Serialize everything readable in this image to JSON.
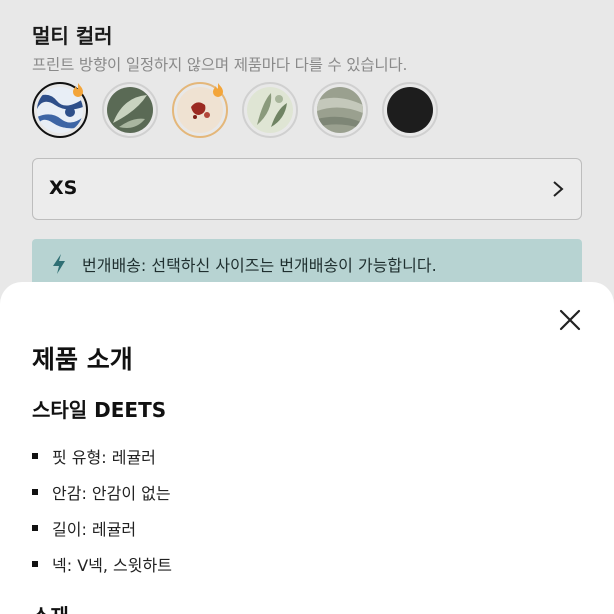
{
  "color_section": {
    "title": "멀티 컬러",
    "subtitle": "프린트 방향이 일정하지 않으며 제품마다 다를 수 있습니다."
  },
  "swatches": [
    {
      "name": "blue-white-print",
      "selected": true,
      "flame": true,
      "colors": [
        "#2e4f8a",
        "#e8eef6"
      ]
    },
    {
      "name": "green-leaf-print",
      "selected": false,
      "flame": false,
      "colors": [
        "#5a6a55",
        "#c9d3c0"
      ]
    },
    {
      "name": "cream-red-print",
      "selected": false,
      "flame": true,
      "colors": [
        "#efe2d2",
        "#9b2a22"
      ]
    },
    {
      "name": "sage-floral-print",
      "selected": false,
      "flame": false,
      "colors": [
        "#8a9a7c",
        "#dfe5d4"
      ]
    },
    {
      "name": "grey-marble-print",
      "selected": false,
      "flame": false,
      "colors": [
        "#7e8676",
        "#c4c8bb"
      ]
    },
    {
      "name": "solid-black",
      "selected": false,
      "flame": false,
      "colors": [
        "#1d1d1d",
        "#1d1d1d"
      ]
    }
  ],
  "size_selector": {
    "value": "XS"
  },
  "shipping_notice": {
    "text": "번개배송: 선택하신 사이즈는 번개배송이 가능합니다."
  },
  "product_sheet": {
    "title": "제품 소개",
    "style_heading": "스타일 DEETS",
    "specs": [
      "핏 유형: 레귤러",
      "안감: 안감이 없는",
      "길이: 레귤러",
      "넥: V넥, 스윗하트"
    ],
    "next_heading": "소재"
  },
  "colors": {
    "flame": "#f3a53a",
    "ship_bg": "#b7d3d2",
    "ship_icon": "#2f6f74"
  }
}
